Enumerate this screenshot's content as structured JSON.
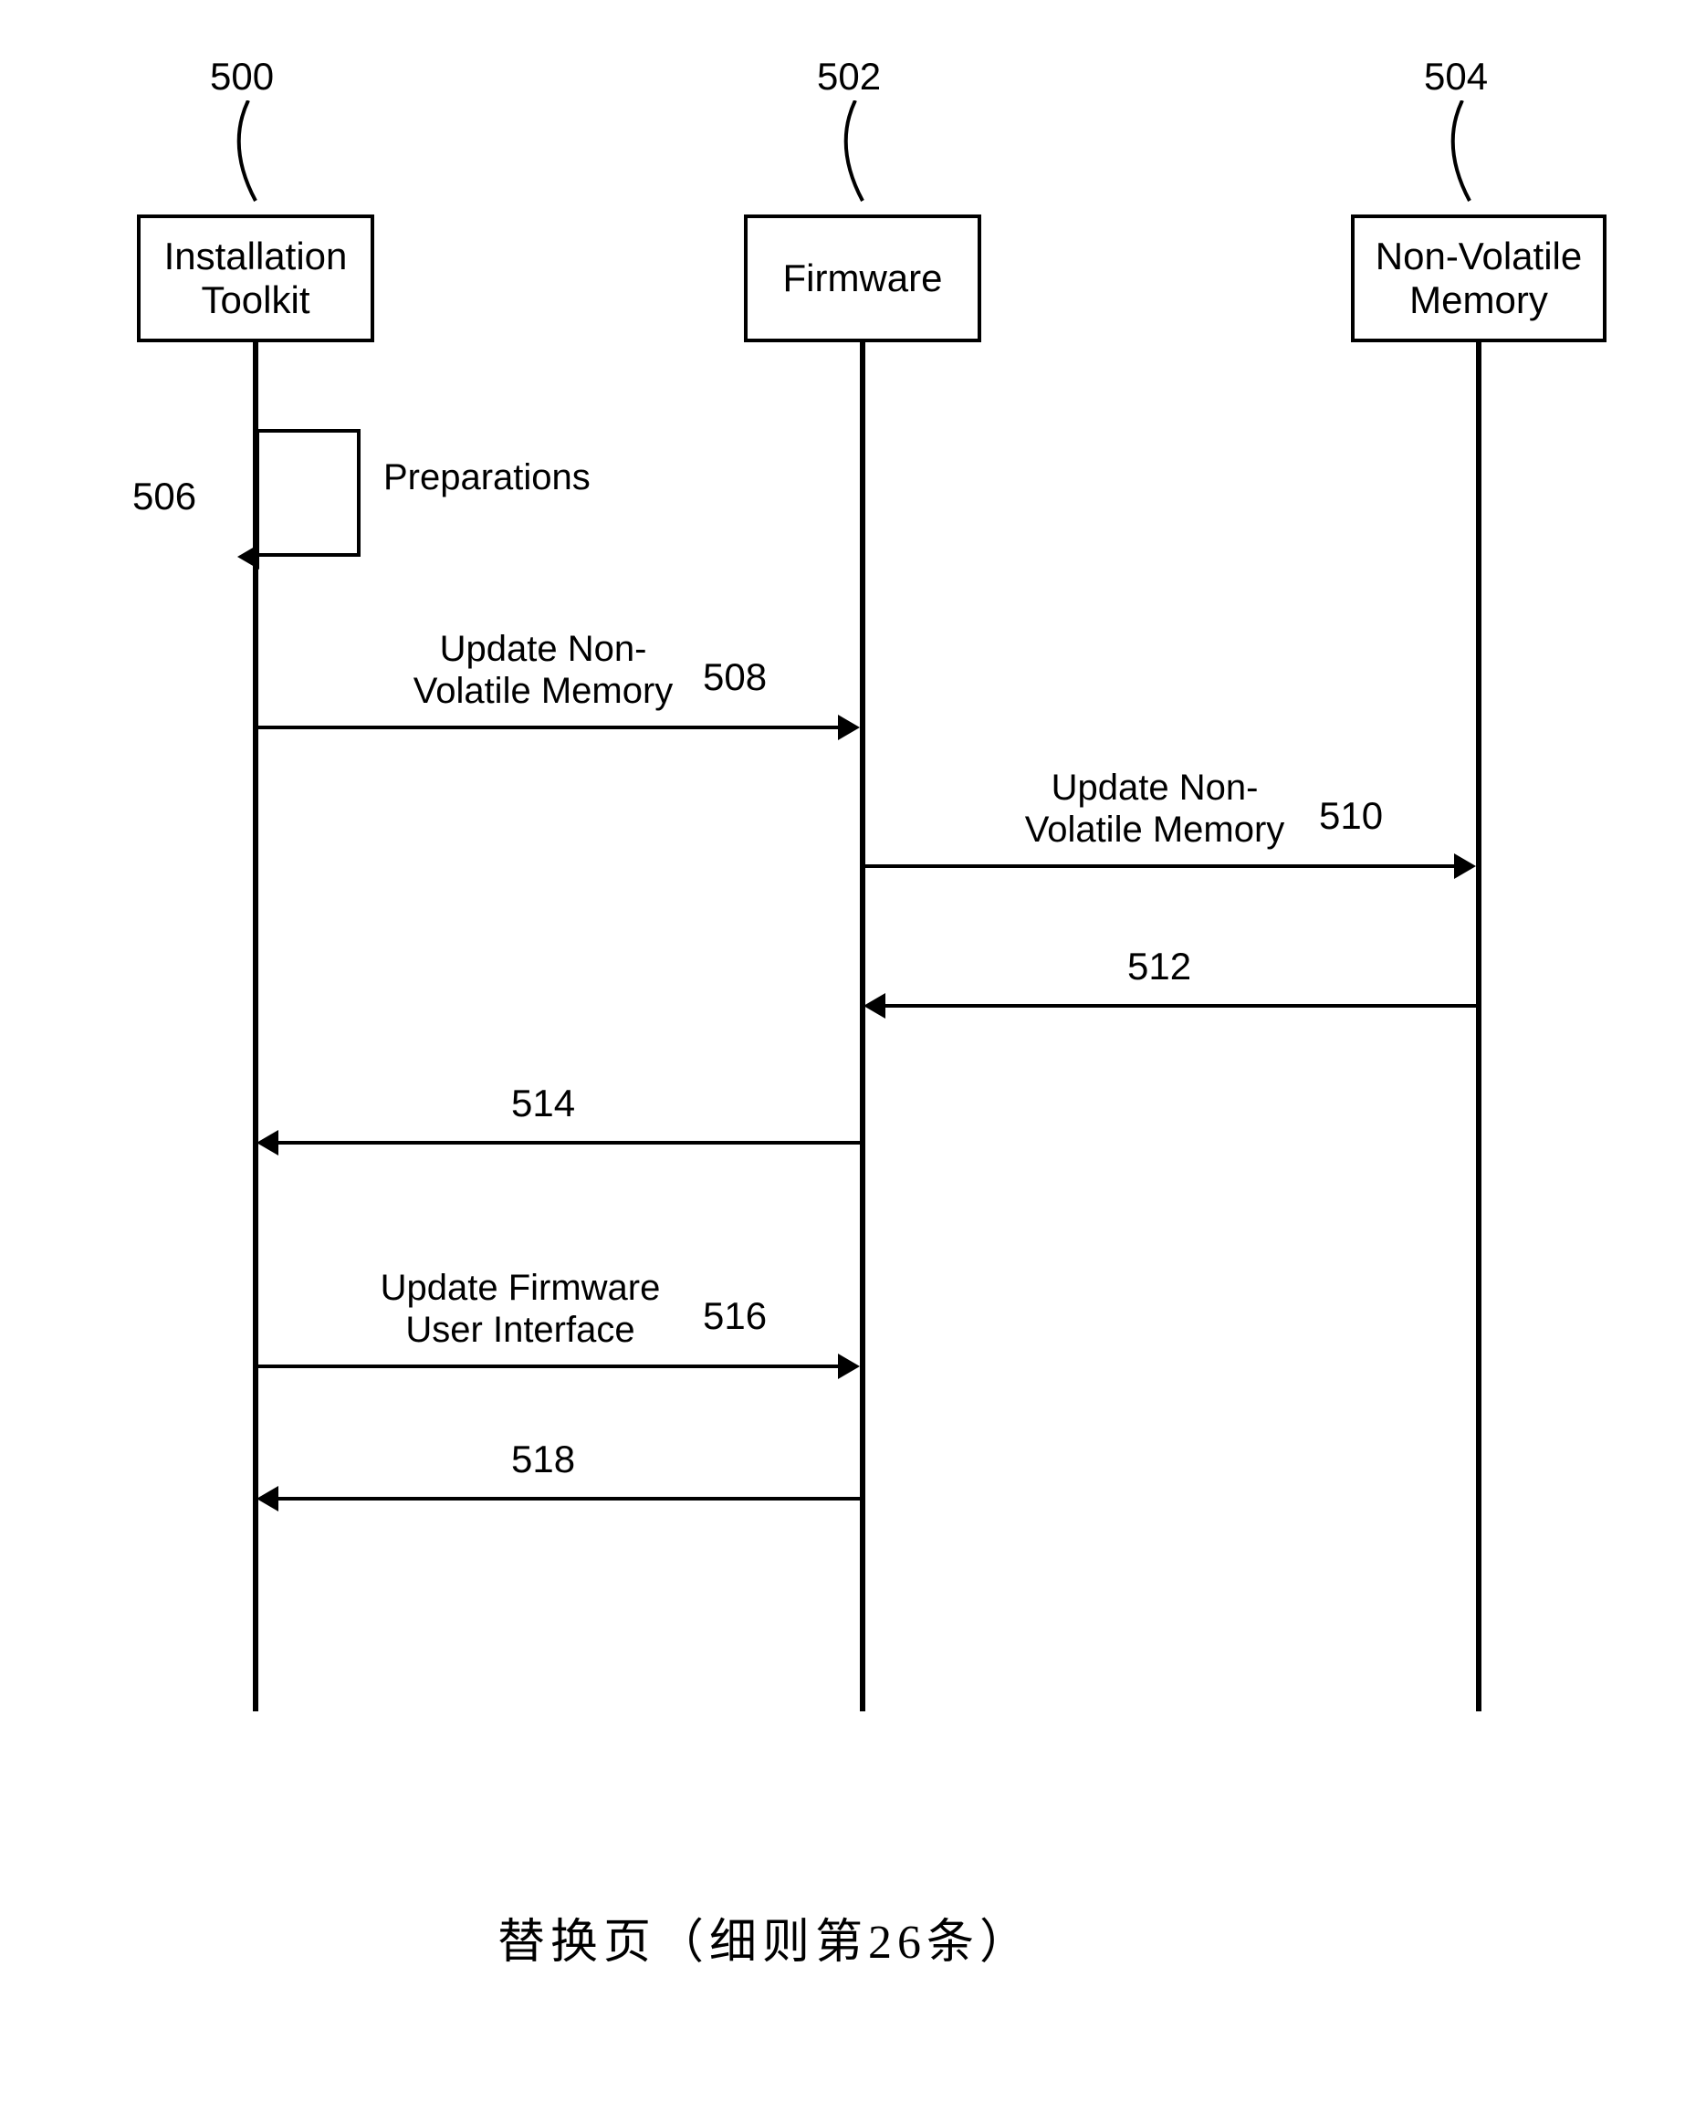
{
  "refs": {
    "r500": "500",
    "r502": "502",
    "r504": "504",
    "r506": "506",
    "r508": "508",
    "r510": "510",
    "r512": "512",
    "r514": "514",
    "r516": "516",
    "r518": "518"
  },
  "participants": {
    "toolkit": "Installation\nToolkit",
    "firmware": "Firmware",
    "nvmem": "Non-Volatile\nMemory"
  },
  "messages": {
    "preparations": "Preparations",
    "update_nvm": "Update Non-\nVolatile Memory",
    "update_nvm2": "Update Non-\nVolatile Memory",
    "update_fw_ui": "Update Firmware\nUser Interface"
  },
  "footer": "替换页（细则第26条）"
}
